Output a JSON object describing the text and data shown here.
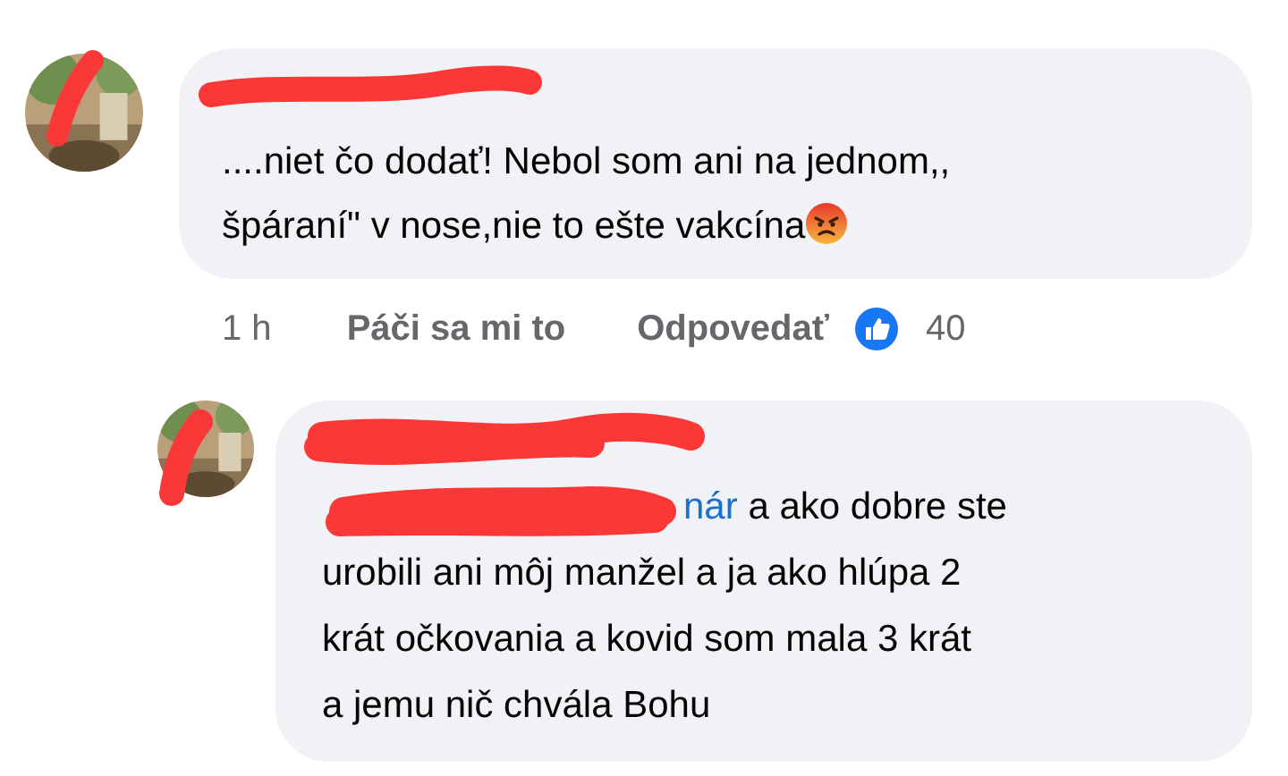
{
  "comment": {
    "lines": [
      "....niet čo dodať! Nebol som ani na jednom,,",
      "špáraní\" v nose,nie to ešte vakcína"
    ],
    "emoji": {
      "kind": "angry"
    },
    "time": "1 h",
    "like_label": "Páči sa mi to",
    "reply_label": "Odpovedať",
    "reaction_count": "40"
  },
  "reply": {
    "mention": "nár",
    "lines": [
      " a ako dobre ste",
      "urobili ani môj manžel a ja ako hlúpa 2",
      "krát očkovania a kovid som mala 3 krát",
      "a jemu nič chvála Bohu"
    ]
  }
}
